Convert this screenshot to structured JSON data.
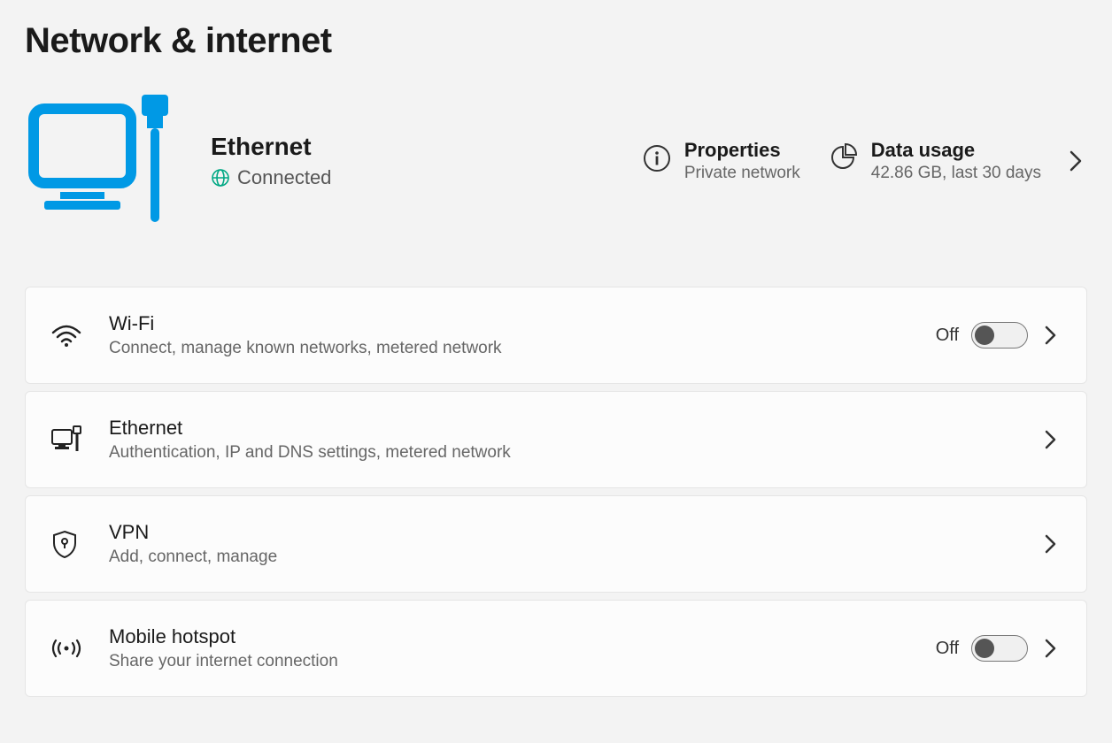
{
  "page": {
    "title": "Network & internet"
  },
  "status": {
    "name": "Ethernet",
    "state": "Connected",
    "properties": {
      "title": "Properties",
      "subtitle": "Private network"
    },
    "dataUsage": {
      "title": "Data usage",
      "subtitle": "42.86 GB, last 30 days"
    }
  },
  "items": [
    {
      "id": "wifi",
      "icon": "wifi-icon",
      "title": "Wi-Fi",
      "subtitle": "Connect, manage known networks, metered network",
      "hasToggle": true,
      "toggleLabel": "Off",
      "toggleOn": false
    },
    {
      "id": "ethernet",
      "icon": "ethernet-icon",
      "title": "Ethernet",
      "subtitle": "Authentication, IP and DNS settings, metered network",
      "hasToggle": false
    },
    {
      "id": "vpn",
      "icon": "shield-icon",
      "title": "VPN",
      "subtitle": "Add, connect, manage",
      "hasToggle": false
    },
    {
      "id": "hotspot",
      "icon": "hotspot-icon",
      "title": "Mobile hotspot",
      "subtitle": "Share your internet connection",
      "hasToggle": true,
      "toggleLabel": "Off",
      "toggleOn": false
    }
  ],
  "colors": {
    "accent": "#0078d4",
    "accentBright": "#0099e5",
    "globe": "#00a884"
  }
}
